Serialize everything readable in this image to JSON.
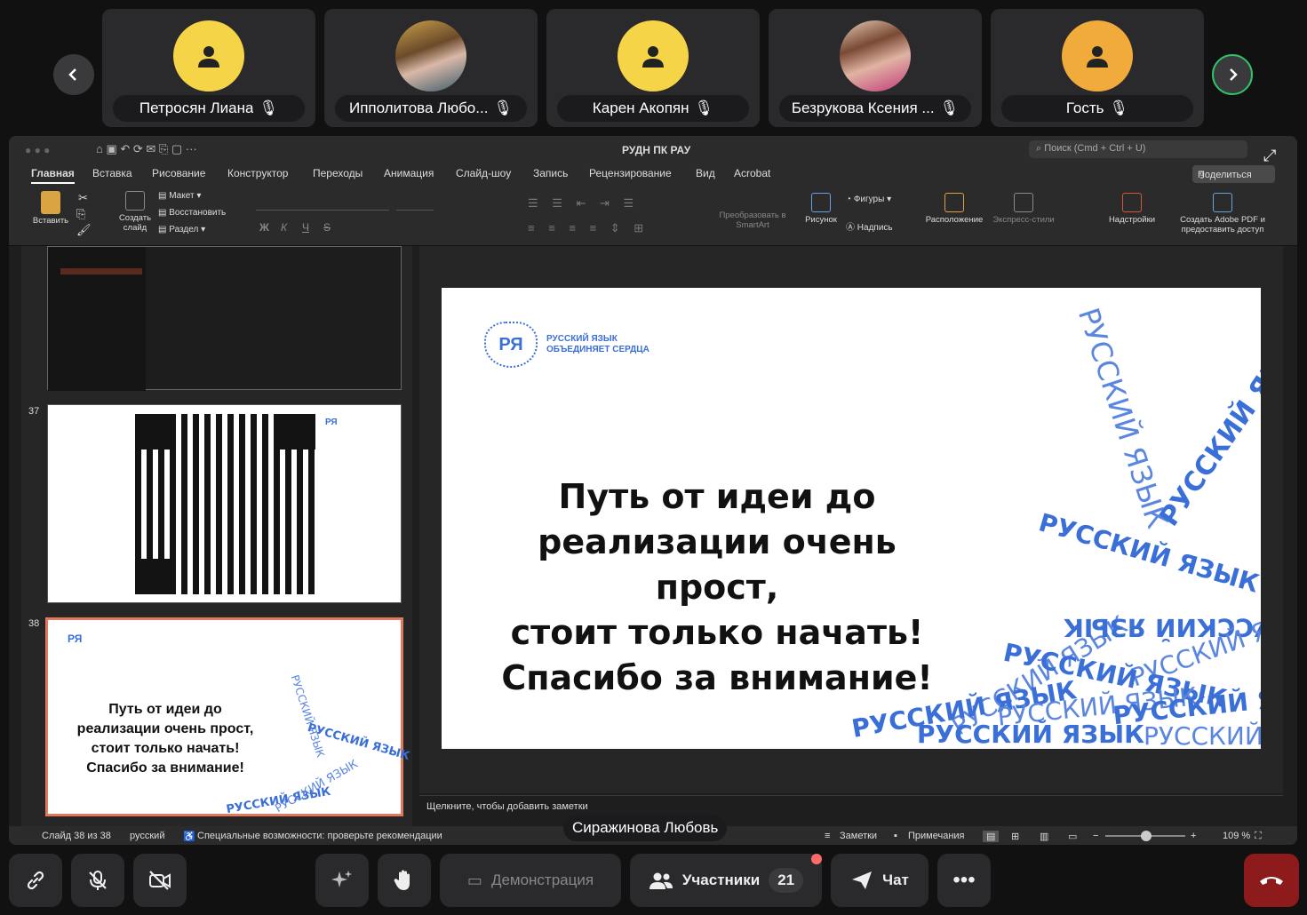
{
  "participants": [
    {
      "name": "Петросян Лиана",
      "avatar": "user-icon",
      "color": "#f5d547"
    },
    {
      "name": "Ипполитова Любо...",
      "avatar": "photo",
      "color": ""
    },
    {
      "name": "Карен Акопян",
      "avatar": "user-icon",
      "color": "#f5d547"
    },
    {
      "name": "Безрукова Ксения ...",
      "avatar": "photo",
      "color": ""
    },
    {
      "name": "Гость",
      "avatar": "user-icon",
      "color": "#f0ab3a"
    }
  ],
  "ppt": {
    "window_title": "РУДН ПК РАУ",
    "search_placeholder": "Поиск (Cmd + Ctrl + U)",
    "share_label": "Поделиться",
    "menu": [
      "Главная",
      "Вставка",
      "Рисование",
      "Конструктор",
      "Переходы",
      "Анимация",
      "Слайд-шоу",
      "Запись",
      "Рецензирование",
      "Вид",
      "Acrobat"
    ],
    "ribbon": {
      "paste": "Вставить",
      "new_slide": "Создать слайд",
      "layout": "Макет",
      "reset": "Восстановить",
      "section": "Раздел",
      "font_btns": [
        "Ж",
        "К",
        "Ч",
        "S"
      ],
      "convert_smartart": "Преобразовать в SmartArt",
      "picture": "Рисунок",
      "shapes": "Фигуры",
      "textbox": "Надпись",
      "arrange": "Расположение",
      "quick_styles": "Экспресс-стили",
      "addins": "Надстройки",
      "adobe_pdf": "Создать Adobe PDF и предоставить доступ"
    },
    "thumbs": [
      {
        "num": "37"
      },
      {
        "num": "38",
        "text": "Путь от идеи до реализации очень прост, стоит только начать! Спасибо за внимание!"
      }
    ],
    "slide": {
      "logo_text_1": "РУССКИЙ ЯЗЫК",
      "logo_text_2": "ОБЪЕДИНЯЕТ СЕРДЦА",
      "logo_mark": "РЯ",
      "title_lines": [
        "Путь от идеи до",
        "реализации очень прост,",
        "стоит только начать!",
        "Спасибо за внимание!"
      ],
      "watermark": "РУССКИЙ ЯЗЫК",
      "watermark_alt": "РУССКИЙ ЯЗЫК",
      "accent": "#3b6fd8"
    },
    "notes_placeholder": "Щелкните, чтобы добавить заметки",
    "status": {
      "slide_counter": "Слайд 38 из 38",
      "language": "русский",
      "accessibility": "Специальные возможности: проверьте рекомендации",
      "notes": "Заметки",
      "comments": "Примечания",
      "zoom": "109 %"
    }
  },
  "speaker_name": "Сиражинова Любовь",
  "toolbar": {
    "screen_share": "Демонстрация",
    "participants": "Участники",
    "participants_count": "21",
    "chat": "Чат",
    "end_call_color": "#8e1b1b"
  }
}
